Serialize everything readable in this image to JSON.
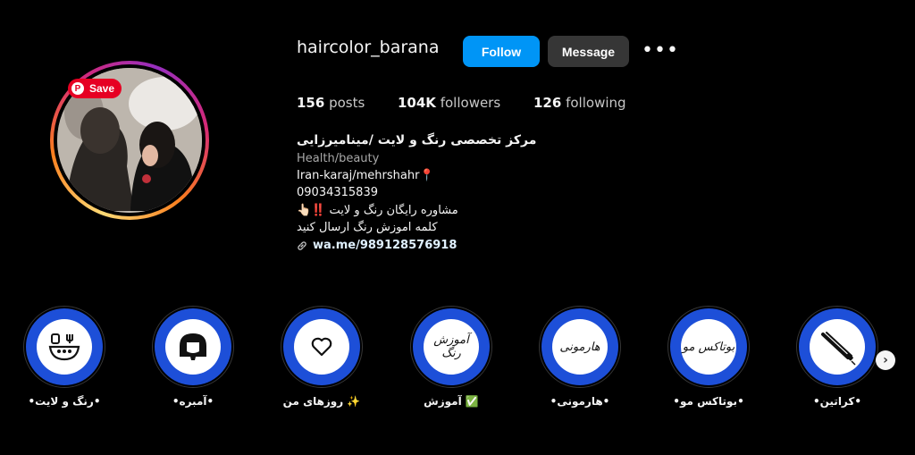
{
  "profile": {
    "username": "haircolor_barana",
    "follow_label": "Follow",
    "message_label": "Message",
    "more_label": "•••",
    "save_label": "Save"
  },
  "stats": [
    {
      "value": "156",
      "label": "posts"
    },
    {
      "value": "104K",
      "label": "followers"
    },
    {
      "value": "126",
      "label": "following"
    }
  ],
  "bio": {
    "name": "مرکز تخصصی رنگ و لایت /مینامیرزایی",
    "category": "Health/beauty",
    "location": "Iran-karaj/mehrshahr📍",
    "phone": "09034315839",
    "line1": "مشاوره رایگان رنگ و لایت ‼️👆🏻",
    "line2": "کلمه اموزش رنگ ارسال کنید",
    "link": "wa.me/989128576918"
  },
  "highlights": [
    {
      "label": "•رنگ و لایت•",
      "icon": "food-bowl-icon"
    },
    {
      "label": "•آمبره•",
      "icon": "hair-icon"
    },
    {
      "label": "روزهای من ✨",
      "icon": "heart-icon"
    },
    {
      "label": "آموزش ✅",
      "icon": "calligraphy-icon",
      "art": "آموزش رنگ"
    },
    {
      "label": "•هارمونی•",
      "icon": "calligraphy-icon",
      "art": "هارمونی"
    },
    {
      "label": "•بوتاکس مو•",
      "icon": "calligraphy-icon",
      "art": "بوتاکس مو"
    },
    {
      "label": "•کراتین•",
      "icon": "flat-iron-icon"
    }
  ],
  "colors": {
    "follow": "#0095f6",
    "message": "#363636",
    "highlight_ring": "#1d4fd8",
    "pinterest": "#e60023"
  }
}
